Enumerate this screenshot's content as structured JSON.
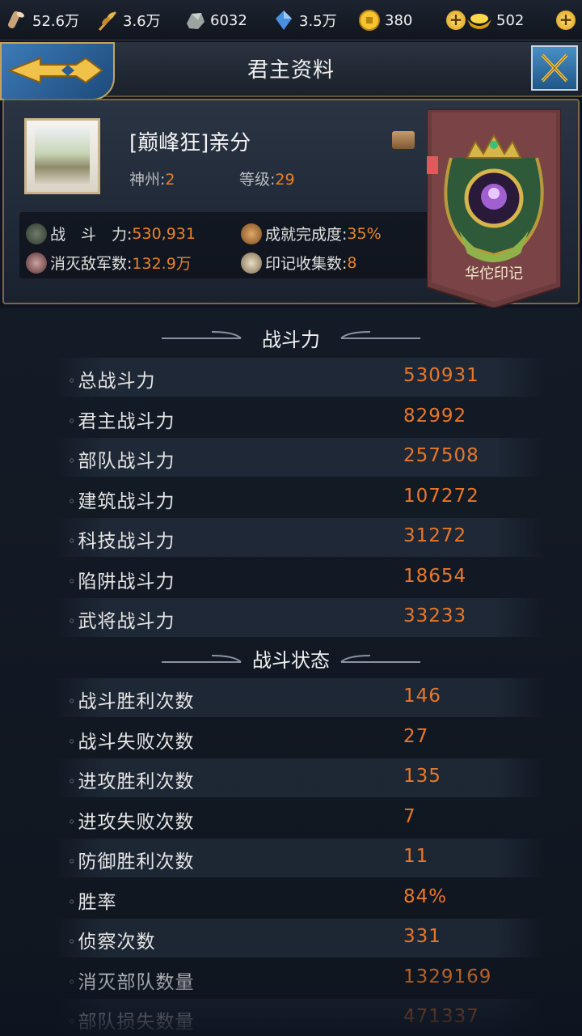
{
  "resources": [
    {
      "icon": "wood-icon",
      "value": "52.6万"
    },
    {
      "icon": "food-icon",
      "value": "3.6万"
    },
    {
      "icon": "stone-icon",
      "value": "6032"
    },
    {
      "icon": "crystal-icon",
      "value": "3.5万"
    },
    {
      "icon": "coin-icon",
      "value": "380"
    },
    {
      "icon": "gold-ingot-icon",
      "value": "502"
    }
  ],
  "header": {
    "title": "君主资料"
  },
  "profile": {
    "name": "[巅峰狂]亲分",
    "region_label": "神州:",
    "region_value": "2",
    "level_label": "等级:",
    "level_value": "29",
    "power_label": "战　斗　力:",
    "power_value": "530,931",
    "achievement_label": "成就完成度:",
    "achievement_value": "35%",
    "kills_label": "消灭敌军数:",
    "kills_value": "132.9万",
    "seals_label": "印记收集数:",
    "seals_value": "8",
    "emblem_label": "华佗印记"
  },
  "sections": {
    "power": {
      "title": "战斗力",
      "rows": [
        {
          "label": "总战斗力",
          "value": "530931"
        },
        {
          "label": "君主战斗力",
          "value": "82992"
        },
        {
          "label": "部队战斗力",
          "value": "257508"
        },
        {
          "label": "建筑战斗力",
          "value": "107272"
        },
        {
          "label": "科技战斗力",
          "value": "31272"
        },
        {
          "label": "陷阱战斗力",
          "value": "18654"
        },
        {
          "label": "武将战斗力",
          "value": "33233"
        }
      ]
    },
    "battle": {
      "title": "战斗状态",
      "rows": [
        {
          "label": "战斗胜利次数",
          "value": "146"
        },
        {
          "label": "战斗失败次数",
          "value": "27"
        },
        {
          "label": "进攻胜利次数",
          "value": "135"
        },
        {
          "label": "进攻失败次数",
          "value": "7"
        },
        {
          "label": "防御胜利次数",
          "value": "11"
        },
        {
          "label": "胜率",
          "value": "84%"
        },
        {
          "label": "侦察次数",
          "value": "331"
        },
        {
          "label": "消灭部队数量",
          "value": "1329169"
        },
        {
          "label": "部队损失数量",
          "value": "471337"
        }
      ]
    }
  },
  "colors": {
    "accent_orange": "#e8772a",
    "frame_gold": "#c4a45c",
    "button_blue": "#3c7bb8"
  }
}
